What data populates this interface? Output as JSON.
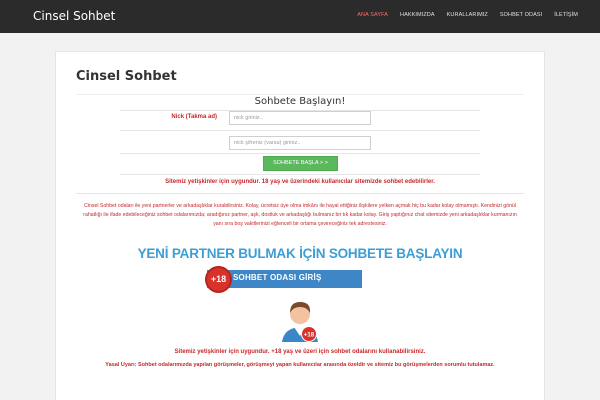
{
  "header": {
    "brand": "Cinsel Sohbet",
    "nav": [
      "ANA SAYFA",
      "HAKKIMIZDA",
      "KURALLARIMIZ",
      "SOHBET ODASI",
      "İLETİŞİM"
    ]
  },
  "main": {
    "title": "Cinsel Sohbet",
    "form": {
      "heading": "Sohbete Başlayın!",
      "nick_label": "Nick (Takma ad)",
      "nick_placeholder": "nick giriniz..",
      "password_placeholder": "nick şifreniz (varsa) giriniz..",
      "submit_label": "SOHBETE BAŞLA > >"
    },
    "adult_notice": "Sitemiz yetişkinler için uygundur. 18 yaş ve üzerindeki kullanıcılar sitemizde sohbet edebilirler.",
    "description": "Cinsel Sohbet odaları ile yeni partnerler ve arkadaşlıklar kurabilirsiniz. Kolay, ücretsiz üye olma imkânı ile hayal ettiğiniz ilişkilere yelken açmak hiç bu kadar kolay olmamıştı. Kendinizi gönül rahatlığı ile ifade edebileceğiniz sohbet odalarımızda; aradığınız partner, aşk, dostluk ve arkadaşlığı bulmanız bir tık kadar kolay. Giriş yaptığınız chat sitemizde yeni arkadaşlıklar kurmanızın yanı sıra boş vakitlerinizi eğlenceli bir ortama çevireceğiniz tek adrestesiniz.",
    "headline": "YENİ PARTNER BULMAK İÇİN SOHBETE BAŞLAYIN",
    "banner": {
      "badge": "+18",
      "label": "SOHBET ODASI GİRİŞ"
    },
    "avatar_badge": "+18",
    "footer_notice": "Sitemiz yetişkinler için uygundur. +18 yaş ve üzeri için sohbet odalarını kullanabilirsiniz.",
    "legal": "Yasal Uyarı: Sohbet odalarımızda yapılan görüşmeler, görüşmeyi yapan kullanıcılar arasında özeldir ve sitemiz bu görüşmelerden sorumlu tutulamaz."
  },
  "colors": {
    "navbar": "#2b2b2b",
    "active_nav": "#ff6b6b",
    "notice_red": "#c6282b",
    "headline_blue": "#3b9fd6",
    "banner_blue": "#3f86c7",
    "button_green": "#5cb85c"
  }
}
